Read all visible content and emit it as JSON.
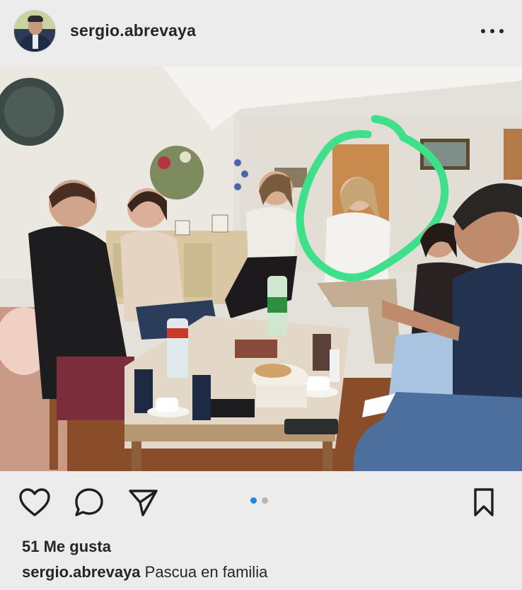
{
  "post": {
    "username": "sergio.abrevaya",
    "more_icon": "ellipsis-horizontal-icon",
    "likes_text": "51 Me gusta",
    "caption_username": "sergio.abrevaya",
    "caption_text": "Pascua en familia"
  },
  "actions": {
    "like_icon": "heart-icon",
    "comment_icon": "comment-bubble-icon",
    "share_icon": "paper-plane-icon",
    "save_icon": "bookmark-icon"
  },
  "carousel": {
    "total": 2,
    "active_index": 0,
    "active_color": "#1e88e5",
    "inactive_color": "#b7b7b7"
  },
  "photo": {
    "description_icon": "photo",
    "highlight_color": "#3fe08a"
  }
}
